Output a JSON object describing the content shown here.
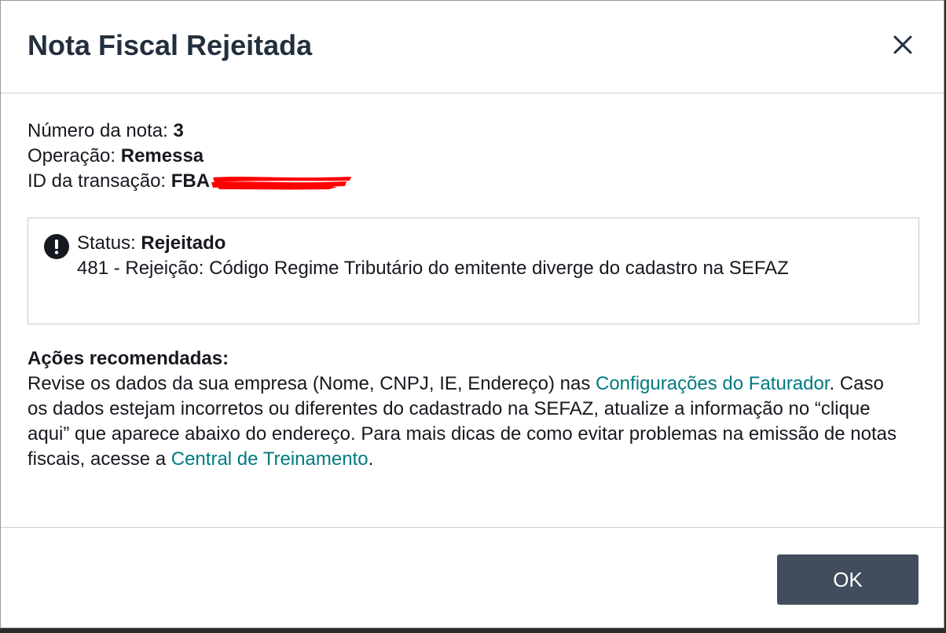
{
  "modal": {
    "title": "Nota Fiscal Rejeitada",
    "close_icon": "close-icon"
  },
  "info": {
    "note_number_label": "Número da nota: ",
    "note_number_value": "3",
    "operation_label": "Operação: ",
    "operation_value": "Remessa",
    "transaction_label": "ID da transação: ",
    "transaction_value_visible": "FBA"
  },
  "status": {
    "icon": "exclamation-circle-icon",
    "label": "Status: ",
    "value": "Rejeitado",
    "message": "481 - Rejeição: Código Regime Tributário do emitente diverge do cadastro na SEFAZ"
  },
  "actions": {
    "heading": "Ações recomendadas:",
    "text_1": "Revise os dados da sua empresa (Nome, CNPJ, IE, Endereço) nas ",
    "link_1": "Configurações do Faturador",
    "text_2": ". Caso os dados estejam incorretos ou diferentes do cadastrado na SEFAZ, atualize a informação no “clique aqui” que aparece abaixo do endereço. Para mais dicas de como evitar problemas na emissão de notas fiscais, acesse a ",
    "link_2": "Central de Treinamento",
    "text_3": "."
  },
  "footer": {
    "ok_label": "OK"
  },
  "colors": {
    "title": "#232f3e",
    "link": "#007a80",
    "button_bg": "#414d5c",
    "redaction": "#ff0000"
  }
}
